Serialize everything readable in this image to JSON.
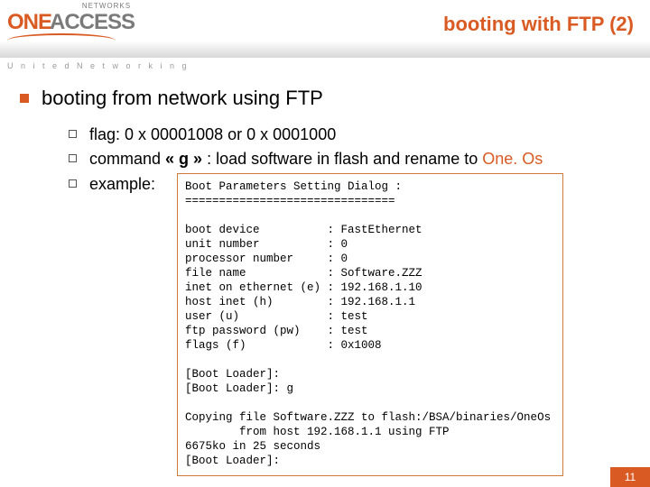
{
  "logo": {
    "one": "ONE",
    "access": "ACCESS",
    "networks": "NETWORKS"
  },
  "tagline": "U n i t e d    N e t w o r k i n g",
  "slide_title": "booting with FTP (2)",
  "main_bullet": "booting from network using FTP",
  "sub": {
    "flag": "flag: 0 x 00001008 or 0 x 0001000",
    "command_pre": "command ",
    "command_g": "« g »",
    "command_mid": " : load software in flash and rename to ",
    "command_brand": "One. Os",
    "example": "example:"
  },
  "terminal": "Boot Parameters Setting Dialog :\n===============================\n\nboot device          : FastEthernet\nunit number          : 0\nprocessor number     : 0\nfile name            : Software.ZZZ\ninet on ethernet (e) : 192.168.1.10\nhost inet (h)        : 192.168.1.1\nuser (u)             : test\nftp password (pw)    : test\nflags (f)            : 0x1008\n\n[Boot Loader]:\n[Boot Loader]: g\n\nCopying file Software.ZZZ to flash:/BSA/binaries/OneOs\n        from host 192.168.1.1 using FTP\n6675ko in 25 seconds\n[Boot Loader]:",
  "page_number": "11"
}
